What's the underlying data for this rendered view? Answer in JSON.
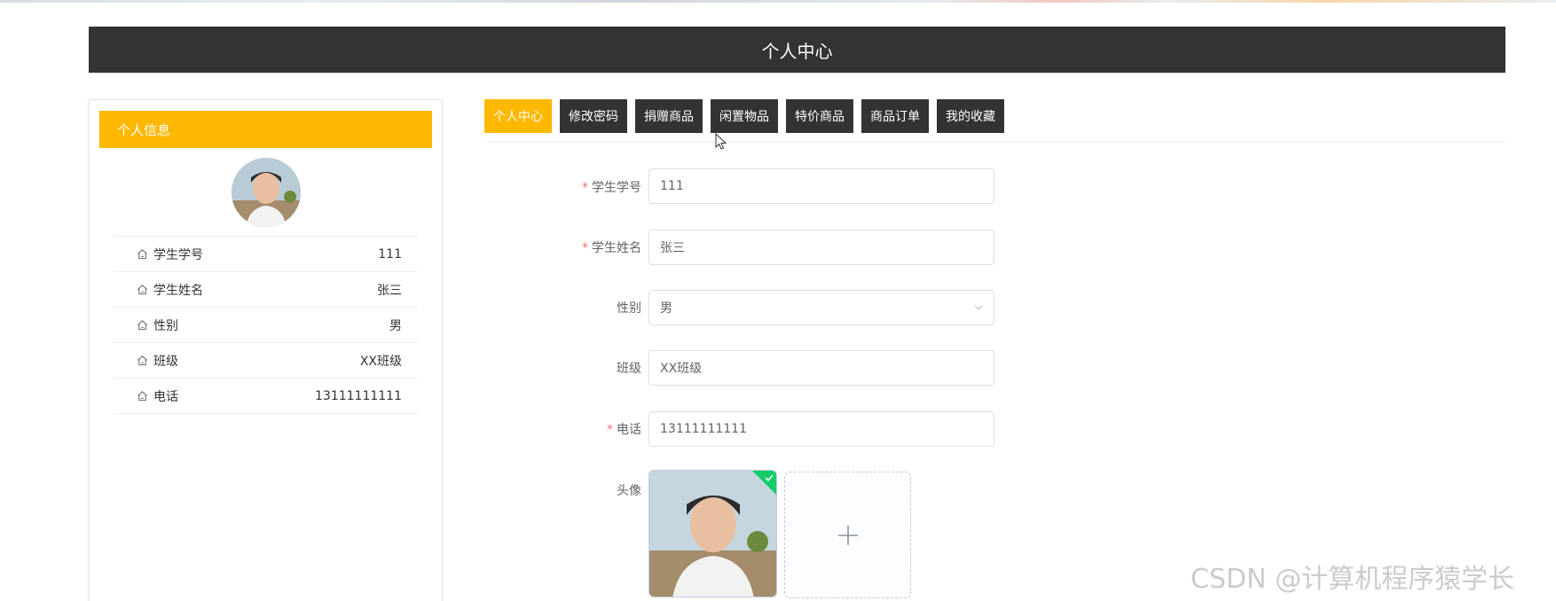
{
  "header": {
    "title": "个人中心"
  },
  "sidebar": {
    "title": "个人信息",
    "rows": [
      {
        "label": "学生学号",
        "value": "111"
      },
      {
        "label": "学生姓名",
        "value": "张三"
      },
      {
        "label": "性别",
        "value": "男"
      },
      {
        "label": "班级",
        "value": "XX班级"
      },
      {
        "label": "电话",
        "value": "13111111111"
      }
    ]
  },
  "tabs": [
    {
      "label": "个人中心",
      "active": true
    },
    {
      "label": "修改密码",
      "active": false
    },
    {
      "label": "捐赠商品",
      "active": false
    },
    {
      "label": "闲置物品",
      "active": false
    },
    {
      "label": "特价商品",
      "active": false
    },
    {
      "label": "商品订单",
      "active": false
    },
    {
      "label": "我的收藏",
      "active": false
    }
  ],
  "form": {
    "student_id": {
      "label": "学生学号",
      "required": true,
      "value": "111"
    },
    "student_name": {
      "label": "学生姓名",
      "required": true,
      "value": "张三"
    },
    "gender": {
      "label": "性别",
      "required": false,
      "value": "男"
    },
    "class": {
      "label": "班级",
      "required": false,
      "value": "XX班级"
    },
    "phone": {
      "label": "电话",
      "required": true,
      "value": "13111111111"
    },
    "avatar": {
      "label": "头像"
    }
  },
  "required_mark": "*",
  "watermark": "CSDN @计算机程序猿学长",
  "colors": {
    "accent": "#FFB800",
    "dark": "#333333",
    "required": "#f56c6c",
    "success": "#13ce66"
  },
  "icons": {
    "row_icon": "home-icon",
    "select": "chevron-down-icon",
    "upload": "plus-icon",
    "uploaded": "check-icon"
  }
}
